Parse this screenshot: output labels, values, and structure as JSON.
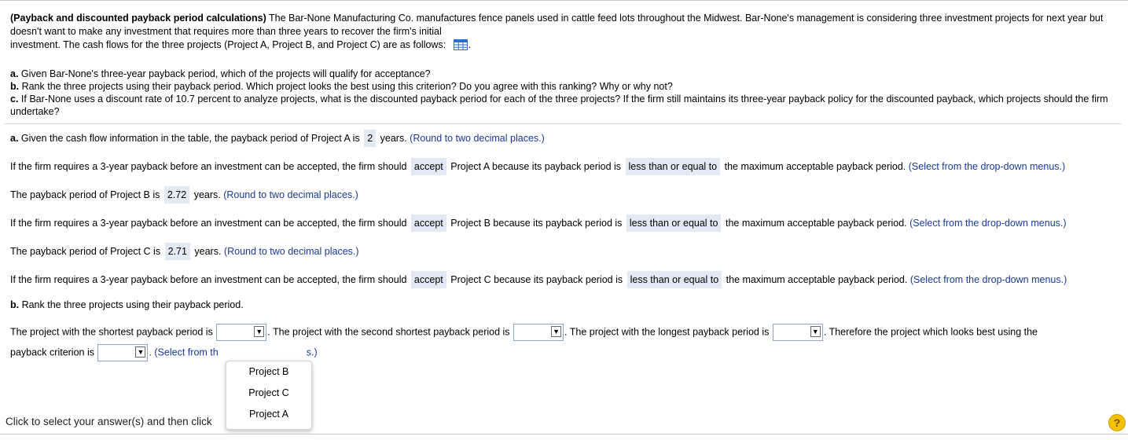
{
  "intro": {
    "bold": "(Payback and discounted payback period calculations)",
    "text1": "  The Bar-None Manufacturing Co. manufactures fence panels used in cattle feed lots throughout the Midwest.  Bar-None's management is considering three investment projects for next year but doesn't want to make any investment that requires more than three years to recover the firm's initial",
    "text2": "investment.  The cash flows for the three projects (Project A, Project B, and Project C) are as follows:",
    "text2_end": "."
  },
  "questions": {
    "a_label": "a.",
    "a_text": " Given Bar-None's three-year payback period, which of the projects will qualify for acceptance?",
    "b_label": "b.",
    "b_text": " Rank the three projects using their payback period.  Which project looks the best using this criterion?  Do you agree with this ranking?  Why or why not?",
    "c_label": "c.",
    "c_text": " If Bar-None uses a discount rate of 10.7 percent to analyze projects, what is the discounted payback period for each of the three projects?  If the firm still maintains its three-year payback policy for the discounted payback, which projects should the firm undertake?"
  },
  "part_a": {
    "label": "a.",
    "l1_text": " Given the cash flow information in the table, the payback period of Project A is",
    "l1_value": "2",
    "years": "years.",
    "round_hint": "(Round to two decimal places.)",
    "req_text": "If the firm requires a 3-year payback before an investment can be accepted, the firm should",
    "decision": "accept",
    "because_a": "Project A because its payback period is",
    "comparison": "less than or equal to",
    "tail": "the maximum acceptable payback period.",
    "select_hint": "(Select from the drop-down menus.)",
    "l3_text": "The payback period of Project B is",
    "l3_value": "2.72",
    "because_b": "Project B because its payback period is",
    "l5_text": "The payback period of Project C is",
    "l5_value": "2.71",
    "because_c": "Project C because its payback period is"
  },
  "part_b": {
    "label": "b.",
    "text": " Rank the three projects using their payback period.",
    "shortest": "The project with the shortest payback period is",
    "second": ". The project with the second shortest payback period is",
    "longest": ". The project with the longest payback period is",
    "therefore": ". Therefore the project which looks best using the",
    "criterion": "payback criterion is",
    "hint_visible": ". (Select from th",
    "hint_tail": "s.)"
  },
  "dropdown_options": [
    "Project B",
    "Project C",
    "Project A"
  ],
  "footer": "Click to select your answer(s) and then click",
  "help_glyph": "?"
}
